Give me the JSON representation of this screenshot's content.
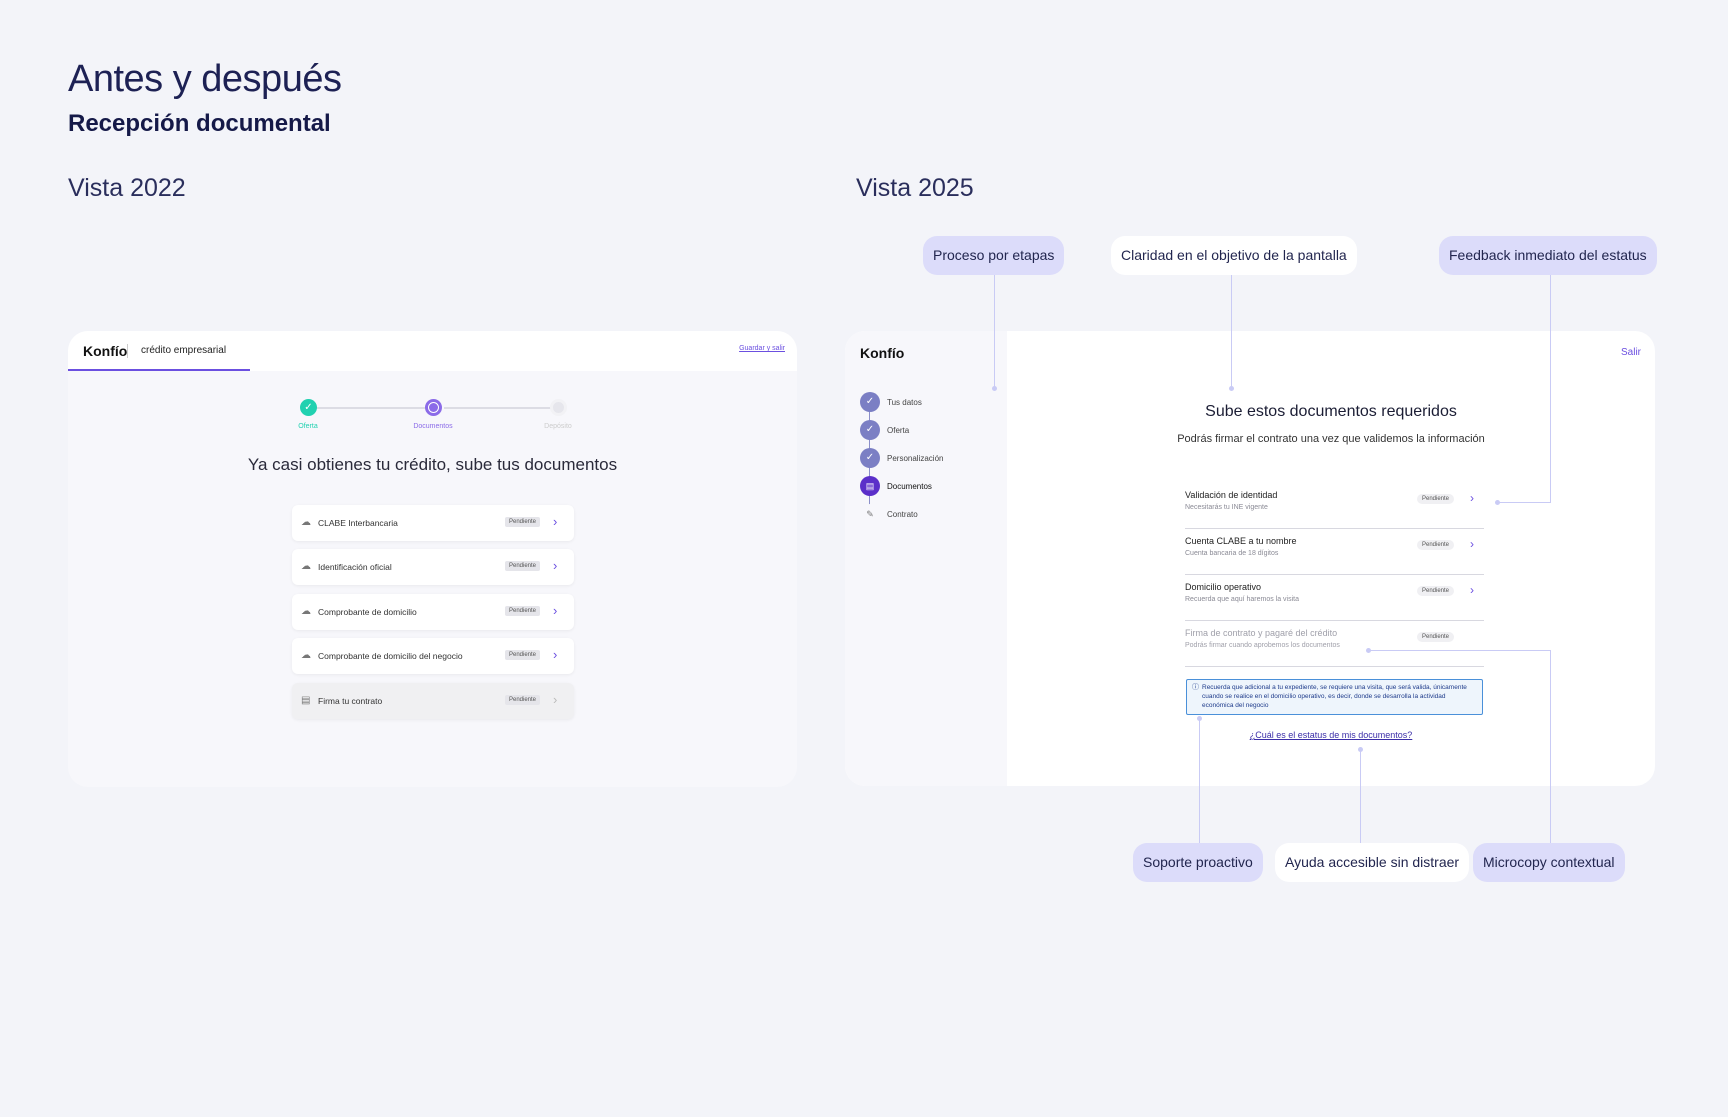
{
  "header": {
    "title": "Antes y después",
    "subtitle": "Recepción documental"
  },
  "views": {
    "left": "Vista 2022",
    "right": "Vista 2025"
  },
  "old_screen": {
    "logo": "Konfío",
    "product": "crédito empresarial",
    "save_exit": "Guardar y salir",
    "steps": [
      {
        "label": "Oferta",
        "state": "done"
      },
      {
        "label": "Documentos",
        "state": "current"
      },
      {
        "label": "Depósito",
        "state": "pending"
      }
    ],
    "heading": "Ya casi obtienes tu crédito, sube tus documentos",
    "documents": [
      {
        "label": "CLABE Interbancaria",
        "status": "Pendiente",
        "icon": "cloud-upload-icon",
        "disabled": false
      },
      {
        "label": "Identificación oficial",
        "status": "Pendiente",
        "icon": "cloud-upload-icon",
        "disabled": false
      },
      {
        "label": "Comprobante de domicilio",
        "status": "Pendiente",
        "icon": "cloud-upload-icon",
        "disabled": false
      },
      {
        "label": "Comprobante de domicilio del negocio",
        "status": "Pendiente",
        "icon": "cloud-upload-icon",
        "disabled": false
      },
      {
        "label": "Firma tu contrato",
        "status": "Pendiente",
        "icon": "document-icon",
        "disabled": true
      }
    ]
  },
  "new_screen": {
    "logo": "Konfío",
    "exit": "Salir",
    "steps": [
      {
        "label": "Tus datos",
        "state": "done"
      },
      {
        "label": "Oferta",
        "state": "done"
      },
      {
        "label": "Personalización",
        "state": "done"
      },
      {
        "label": "Documentos",
        "state": "current"
      },
      {
        "label": "Contrato",
        "state": "pending"
      }
    ],
    "heading": "Sube estos documentos requeridos",
    "description": "Podrás firmar el contrato una vez que validemos la información",
    "documents": [
      {
        "title": "Validación de identidad",
        "subtitle": "Necesitarás tu INE vigente",
        "status": "Pendiente",
        "chevron": true
      },
      {
        "title": "Cuenta CLABE a tu nombre",
        "subtitle": "Cuenta bancaria de 18 dígitos",
        "status": "Pendiente",
        "chevron": true
      },
      {
        "title": "Domicilio operativo",
        "subtitle": "Recuerda que aquí haremos la visita",
        "status": "Pendiente",
        "chevron": true
      },
      {
        "title": "Firma de contrato y pagaré del crédito",
        "subtitle": "Podrás firmar cuando aprobemos los documentos",
        "status": "Pendiente",
        "chevron": false
      }
    ],
    "info": "Recuerda que adicional a tu expediente, se requiere una visita, que será valida, únicamente cuando se realice en el domicilio operativo, es decir, donde se desarrolla la actividad económica del negocio",
    "help_link": "¿Cuál es el estatus de mis documentos?"
  },
  "annotations": {
    "proceso": "Proceso por etapas",
    "claridad": "Claridad en el objetivo de la pantalla",
    "feedback": "Feedback inmediato del estatus",
    "soporte": "Soporte proactivo",
    "ayuda": "Ayuda accesible sin distraer",
    "microcopy": "Microcopy contextual"
  },
  "colors": {
    "accent": "#6b4fe0",
    "teal": "#21d1b0",
    "annotation_bg": "#dcdcfa",
    "step_done": "#7b7fc4"
  }
}
